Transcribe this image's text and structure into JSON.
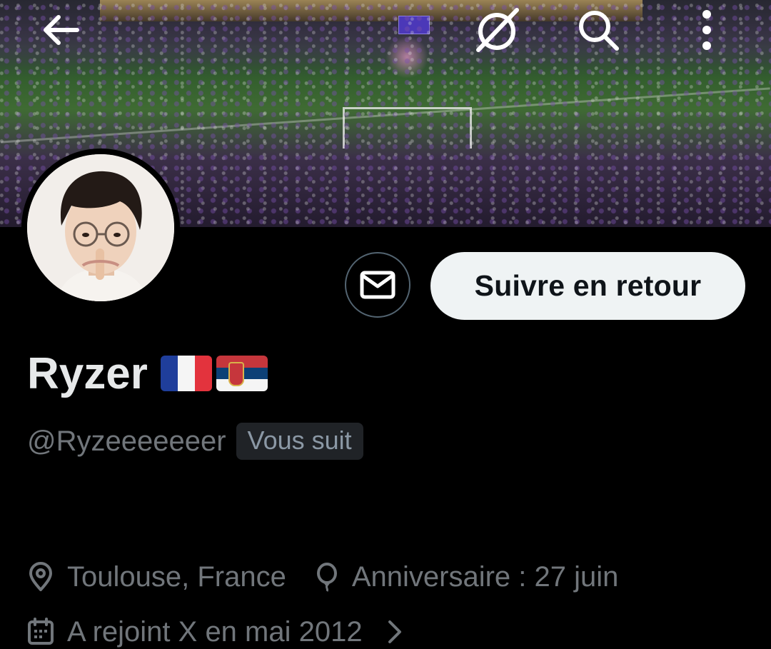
{
  "header": {
    "back_icon": "arrow-left-icon",
    "grok_icon": "grok-icon",
    "search_icon": "search-icon",
    "more_icon": "more-vertical-icon"
  },
  "banner": {
    "image": "stadium crowd photo"
  },
  "profile": {
    "display_name": "Ryzer",
    "flags": [
      "France",
      "Serbia"
    ],
    "handle": "@Ryzeeeeeeer",
    "follows_you_badge": "Vous suit",
    "location": "Toulouse, France",
    "birthday": "Anniversaire : 27 juin",
    "joined": "A rejoint X en mai 2012"
  },
  "actions": {
    "message_icon": "envelope-icon",
    "follow_back_label": "Suivre en retour"
  },
  "colors": {
    "background": "#000000",
    "primary_text": "#e7e9ea",
    "secondary_text": "#71767b",
    "button_bg": "#eff3f4",
    "button_text": "#0f1419",
    "badge_bg": "#202327"
  }
}
